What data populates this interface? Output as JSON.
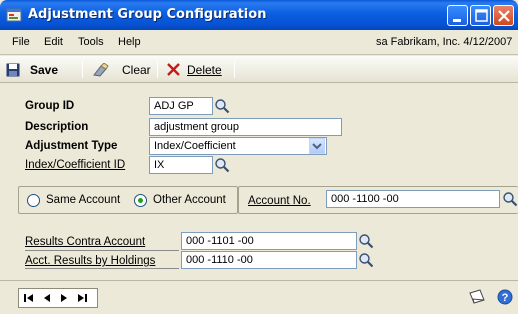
{
  "window": {
    "title": "Adjustment Group Configuration",
    "icons": [
      "app-window-icon",
      "minimize-icon",
      "maximize-icon",
      "close-icon"
    ]
  },
  "menu": {
    "items": [
      "File",
      "Edit",
      "Tools",
      "Help"
    ],
    "user_info": "sa  Fabrikam, Inc.  4/12/2007"
  },
  "toolbar": {
    "save_label": "Save",
    "clear_label": "Clear",
    "delete_label": "Delete"
  },
  "form": {
    "group_id_label": "Group ID",
    "group_id_value": "ADJ GP",
    "description_label": "Description",
    "description_value": "adjustment group",
    "adjustment_type_label": "Adjustment Type",
    "adjustment_type_value": "Index/Coefficient",
    "index_label": "Index/Coefficient ID",
    "index_value": "IX",
    "same_account_label": "Same Account",
    "other_account_label": "Other Account",
    "selected_account_option": "Other Account",
    "account_no_label": "Account No.",
    "account_no_value": "000 -1100 -00",
    "results_contra_label": "Results Contra Account",
    "results_contra_value": "000 -1101 -00",
    "acct_results_label": "Acct. Results by Holdings",
    "acct_results_value": "000 -1110 -00"
  },
  "colors": {
    "titlebar": "#0b5fe0",
    "window_bg": "#ece9d8",
    "field_border": "#7f9db9",
    "radio_selected": "#21a121"
  }
}
